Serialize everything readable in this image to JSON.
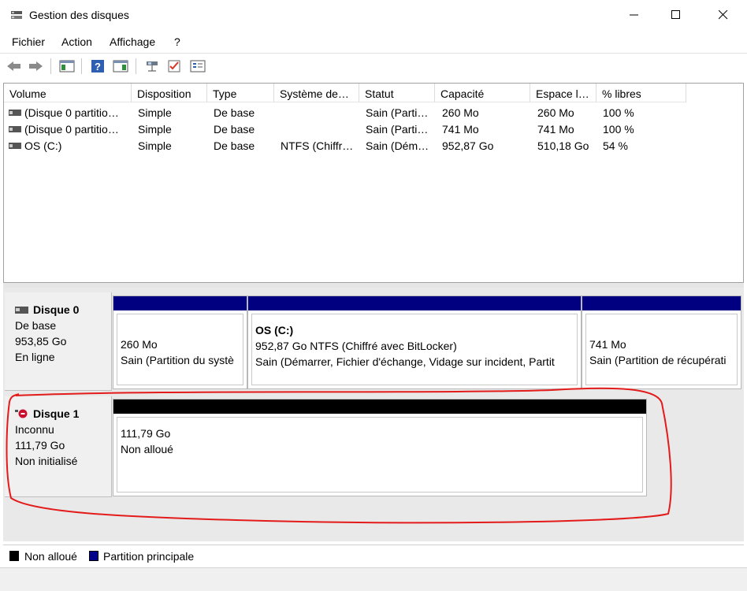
{
  "window": {
    "title": "Gestion des disques"
  },
  "menu": [
    "Fichier",
    "Action",
    "Affichage",
    "?"
  ],
  "toolbar": {
    "buttons": [
      "back-icon",
      "forward-icon",
      "console-tree-icon",
      "help-icon",
      "action-pane-icon",
      "connect-icon",
      "checklist-icon",
      "properties-icon"
    ]
  },
  "volume_list": {
    "columns": [
      "Volume",
      "Disposition",
      "Type",
      "Système de…",
      "Statut",
      "Capacité",
      "Espace l…",
      "% libres"
    ],
    "rows": [
      [
        "(Disque 0 partitio…",
        "Simple",
        "De base",
        "",
        "Sain (Parti…",
        "260 Mo",
        "260 Mo",
        "100 %"
      ],
      [
        "(Disque 0 partitio…",
        "Simple",
        "De base",
        "",
        "Sain (Parti…",
        "741 Mo",
        "741 Mo",
        "100 %"
      ],
      [
        "OS (C:)",
        "Simple",
        "De base",
        "NTFS (Chiffr…",
        "Sain (Dém…",
        "952,87 Go",
        "510,18 Go",
        "54 %"
      ]
    ]
  },
  "disks": {
    "disk0": {
      "name": "Disque 0",
      "type": "De base",
      "size": "953,85 Go",
      "status": "En ligne",
      "partitions": {
        "p1": {
          "line1": "260 Mo",
          "line2": "Sain (Partition du systè"
        },
        "p2": {
          "title": "OS  (C:)",
          "line1": "952,87 Go NTFS (Chiffré avec BitLocker)",
          "line2": "Sain (Démarrer, Fichier d'échange, Vidage sur incident, Partit"
        },
        "p3": {
          "line1": "741 Mo",
          "line2": "Sain (Partition de récupérati"
        }
      }
    },
    "disk1": {
      "name": "Disque 1",
      "type": "Inconnu",
      "size": "111,79 Go",
      "status": "Non initialisé",
      "partition": {
        "line1": "111,79 Go",
        "line2": "Non alloué"
      }
    }
  },
  "legend": [
    {
      "label": "Non alloué",
      "color": "#000000"
    },
    {
      "label": "Partition principale",
      "color": "#00008b"
    }
  ],
  "colors": {
    "primary_partition": "#000080",
    "unallocated": "#000000",
    "annotation": "#e41b1b"
  }
}
